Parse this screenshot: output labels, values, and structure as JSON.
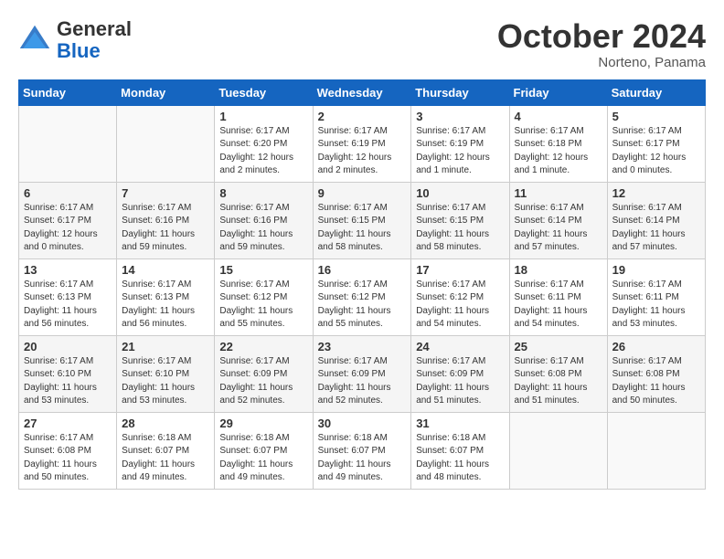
{
  "header": {
    "logo": {
      "general": "General",
      "blue": "Blue"
    },
    "month_title": "October 2024",
    "subtitle": "Norteno, Panama"
  },
  "weekdays": [
    "Sunday",
    "Monday",
    "Tuesday",
    "Wednesday",
    "Thursday",
    "Friday",
    "Saturday"
  ],
  "weeks": [
    [
      {
        "day": "",
        "sunrise": "",
        "sunset": "",
        "daylight": ""
      },
      {
        "day": "",
        "sunrise": "",
        "sunset": "",
        "daylight": ""
      },
      {
        "day": "1",
        "sunrise": "Sunrise: 6:17 AM",
        "sunset": "Sunset: 6:20 PM",
        "daylight": "Daylight: 12 hours and 2 minutes."
      },
      {
        "day": "2",
        "sunrise": "Sunrise: 6:17 AM",
        "sunset": "Sunset: 6:19 PM",
        "daylight": "Daylight: 12 hours and 2 minutes."
      },
      {
        "day": "3",
        "sunrise": "Sunrise: 6:17 AM",
        "sunset": "Sunset: 6:19 PM",
        "daylight": "Daylight: 12 hours and 1 minute."
      },
      {
        "day": "4",
        "sunrise": "Sunrise: 6:17 AM",
        "sunset": "Sunset: 6:18 PM",
        "daylight": "Daylight: 12 hours and 1 minute."
      },
      {
        "day": "5",
        "sunrise": "Sunrise: 6:17 AM",
        "sunset": "Sunset: 6:17 PM",
        "daylight": "Daylight: 12 hours and 0 minutes."
      }
    ],
    [
      {
        "day": "6",
        "sunrise": "Sunrise: 6:17 AM",
        "sunset": "Sunset: 6:17 PM",
        "daylight": "Daylight: 12 hours and 0 minutes."
      },
      {
        "day": "7",
        "sunrise": "Sunrise: 6:17 AM",
        "sunset": "Sunset: 6:16 PM",
        "daylight": "Daylight: 11 hours and 59 minutes."
      },
      {
        "day": "8",
        "sunrise": "Sunrise: 6:17 AM",
        "sunset": "Sunset: 6:16 PM",
        "daylight": "Daylight: 11 hours and 59 minutes."
      },
      {
        "day": "9",
        "sunrise": "Sunrise: 6:17 AM",
        "sunset": "Sunset: 6:15 PM",
        "daylight": "Daylight: 11 hours and 58 minutes."
      },
      {
        "day": "10",
        "sunrise": "Sunrise: 6:17 AM",
        "sunset": "Sunset: 6:15 PM",
        "daylight": "Daylight: 11 hours and 58 minutes."
      },
      {
        "day": "11",
        "sunrise": "Sunrise: 6:17 AM",
        "sunset": "Sunset: 6:14 PM",
        "daylight": "Daylight: 11 hours and 57 minutes."
      },
      {
        "day": "12",
        "sunrise": "Sunrise: 6:17 AM",
        "sunset": "Sunset: 6:14 PM",
        "daylight": "Daylight: 11 hours and 57 minutes."
      }
    ],
    [
      {
        "day": "13",
        "sunrise": "Sunrise: 6:17 AM",
        "sunset": "Sunset: 6:13 PM",
        "daylight": "Daylight: 11 hours and 56 minutes."
      },
      {
        "day": "14",
        "sunrise": "Sunrise: 6:17 AM",
        "sunset": "Sunset: 6:13 PM",
        "daylight": "Daylight: 11 hours and 56 minutes."
      },
      {
        "day": "15",
        "sunrise": "Sunrise: 6:17 AM",
        "sunset": "Sunset: 6:12 PM",
        "daylight": "Daylight: 11 hours and 55 minutes."
      },
      {
        "day": "16",
        "sunrise": "Sunrise: 6:17 AM",
        "sunset": "Sunset: 6:12 PM",
        "daylight": "Daylight: 11 hours and 55 minutes."
      },
      {
        "day": "17",
        "sunrise": "Sunrise: 6:17 AM",
        "sunset": "Sunset: 6:12 PM",
        "daylight": "Daylight: 11 hours and 54 minutes."
      },
      {
        "day": "18",
        "sunrise": "Sunrise: 6:17 AM",
        "sunset": "Sunset: 6:11 PM",
        "daylight": "Daylight: 11 hours and 54 minutes."
      },
      {
        "day": "19",
        "sunrise": "Sunrise: 6:17 AM",
        "sunset": "Sunset: 6:11 PM",
        "daylight": "Daylight: 11 hours and 53 minutes."
      }
    ],
    [
      {
        "day": "20",
        "sunrise": "Sunrise: 6:17 AM",
        "sunset": "Sunset: 6:10 PM",
        "daylight": "Daylight: 11 hours and 53 minutes."
      },
      {
        "day": "21",
        "sunrise": "Sunrise: 6:17 AM",
        "sunset": "Sunset: 6:10 PM",
        "daylight": "Daylight: 11 hours and 53 minutes."
      },
      {
        "day": "22",
        "sunrise": "Sunrise: 6:17 AM",
        "sunset": "Sunset: 6:09 PM",
        "daylight": "Daylight: 11 hours and 52 minutes."
      },
      {
        "day": "23",
        "sunrise": "Sunrise: 6:17 AM",
        "sunset": "Sunset: 6:09 PM",
        "daylight": "Daylight: 11 hours and 52 minutes."
      },
      {
        "day": "24",
        "sunrise": "Sunrise: 6:17 AM",
        "sunset": "Sunset: 6:09 PM",
        "daylight": "Daylight: 11 hours and 51 minutes."
      },
      {
        "day": "25",
        "sunrise": "Sunrise: 6:17 AM",
        "sunset": "Sunset: 6:08 PM",
        "daylight": "Daylight: 11 hours and 51 minutes."
      },
      {
        "day": "26",
        "sunrise": "Sunrise: 6:17 AM",
        "sunset": "Sunset: 6:08 PM",
        "daylight": "Daylight: 11 hours and 50 minutes."
      }
    ],
    [
      {
        "day": "27",
        "sunrise": "Sunrise: 6:17 AM",
        "sunset": "Sunset: 6:08 PM",
        "daylight": "Daylight: 11 hours and 50 minutes."
      },
      {
        "day": "28",
        "sunrise": "Sunrise: 6:18 AM",
        "sunset": "Sunset: 6:07 PM",
        "daylight": "Daylight: 11 hours and 49 minutes."
      },
      {
        "day": "29",
        "sunrise": "Sunrise: 6:18 AM",
        "sunset": "Sunset: 6:07 PM",
        "daylight": "Daylight: 11 hours and 49 minutes."
      },
      {
        "day": "30",
        "sunrise": "Sunrise: 6:18 AM",
        "sunset": "Sunset: 6:07 PM",
        "daylight": "Daylight: 11 hours and 49 minutes."
      },
      {
        "day": "31",
        "sunrise": "Sunrise: 6:18 AM",
        "sunset": "Sunset: 6:07 PM",
        "daylight": "Daylight: 11 hours and 48 minutes."
      },
      {
        "day": "",
        "sunrise": "",
        "sunset": "",
        "daylight": ""
      },
      {
        "day": "",
        "sunrise": "",
        "sunset": "",
        "daylight": ""
      }
    ]
  ]
}
